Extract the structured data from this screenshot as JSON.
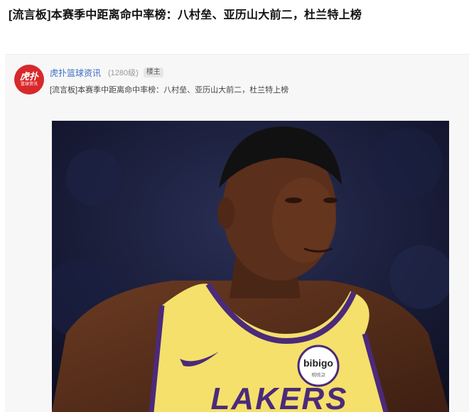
{
  "page": {
    "title": "[流言板]本赛季中距离命中率榜：八村垒、亚历山大前二，杜兰特上榜"
  },
  "post": {
    "author": {
      "name": "虎扑篮球资讯",
      "level": "(1280级)",
      "badge": "楼主",
      "avatar_logo_top": "虎扑",
      "avatar_logo_bottom": "篮球资讯"
    },
    "subtitle": "[流言板]本赛季中距离命中率榜：八村垒、亚历山大前二，杜兰特上榜",
    "image": {
      "jersey_text": "LAKERS",
      "patch_text": "bibigo",
      "patch_subtext": "비비고"
    }
  },
  "colors": {
    "author_link": "#3a6cc4",
    "avatar_bg": "#d8282b",
    "jersey_yellow": "#f4e06a",
    "jersey_purple": "#4b2a7a"
  }
}
